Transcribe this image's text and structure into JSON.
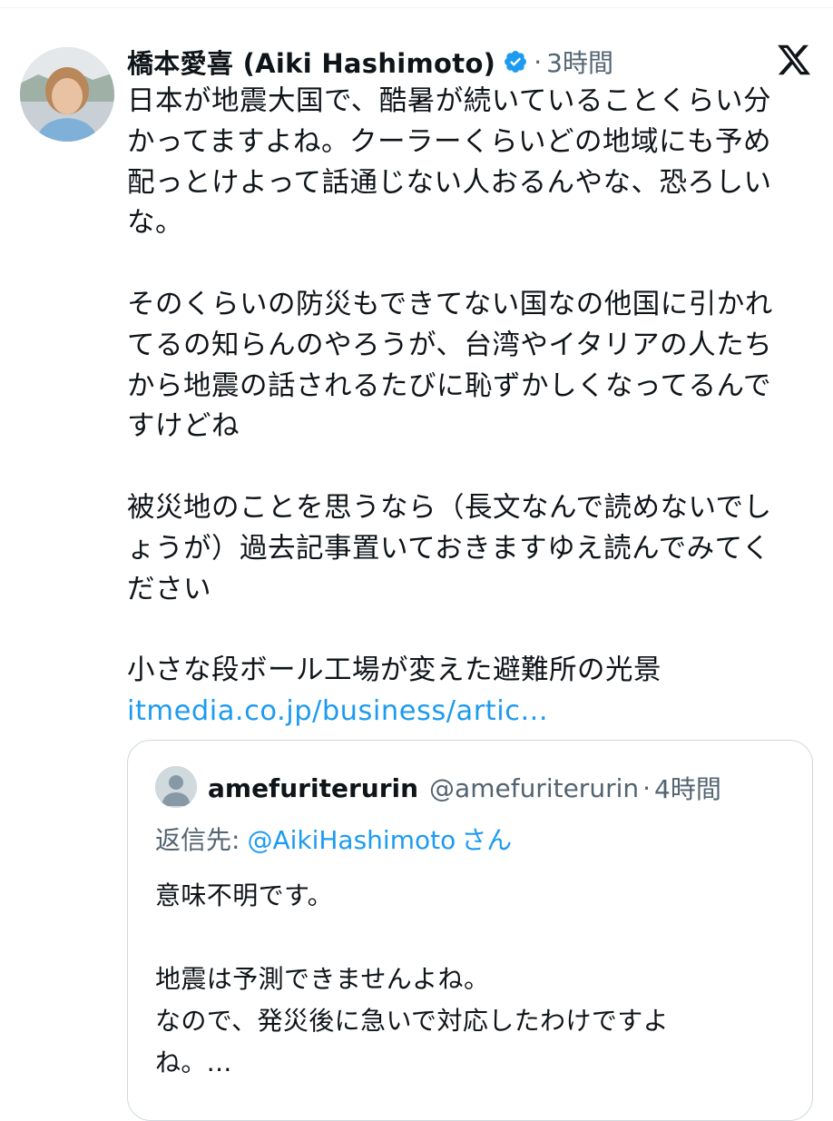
{
  "author": {
    "display_name": "橋本愛喜 (Aiki Hashimoto)",
    "timestamp": "3時間",
    "verified": true
  },
  "icons": {
    "verified": "verified-badge-icon",
    "platform": "x-logo-icon",
    "avatar_placeholder": "default-avatar-icon"
  },
  "colors": {
    "link": "#1d9bf0",
    "secondary_text": "#536471",
    "border": "#cfd9de"
  },
  "tweet": {
    "paragraphs": [
      {
        "lines": [
          "日本が地震大国で、酷暑が続いていることくらい分",
          "かってますよね。クーラーくらいどの地域にも予め",
          "配っとけよって話通じない人おるんやな、恐ろしい",
          "な。"
        ]
      },
      {
        "lines": [
          "そのくらいの防災もできてない国なの他国に引かれ",
          "てるの知らんのやろうが、台湾やイタリアの人たち",
          "から地震の話されるたびに恥ずかしくなってるんで",
          "すけどね"
        ]
      },
      {
        "lines": [
          "被災地のことを思うなら（長文なんで読めないでし",
          "ょうが）過去記事置いておきますゆえ読んでみてく",
          "ださい"
        ]
      },
      {
        "lines": [
          "小さな段ボール工場が変えた避難所の光景"
        ]
      }
    ],
    "link_text": "itmedia.co.jp/business/artic..."
  },
  "quoted_tweet": {
    "display_name": "amefuriterurin",
    "handle": "@amefuriterurin",
    "timestamp": "4時間",
    "reply_prefix": "返信先:",
    "reply_user": "@AikiHashimoto",
    "reply_suffix": "さん",
    "paragraphs": [
      {
        "lines": [
          "意味不明です。"
        ]
      },
      {
        "lines": [
          "地震は予測できませんよね。",
          "なので、発災後に急いで対応したわけですよ",
          "ね。..."
        ]
      }
    ]
  }
}
